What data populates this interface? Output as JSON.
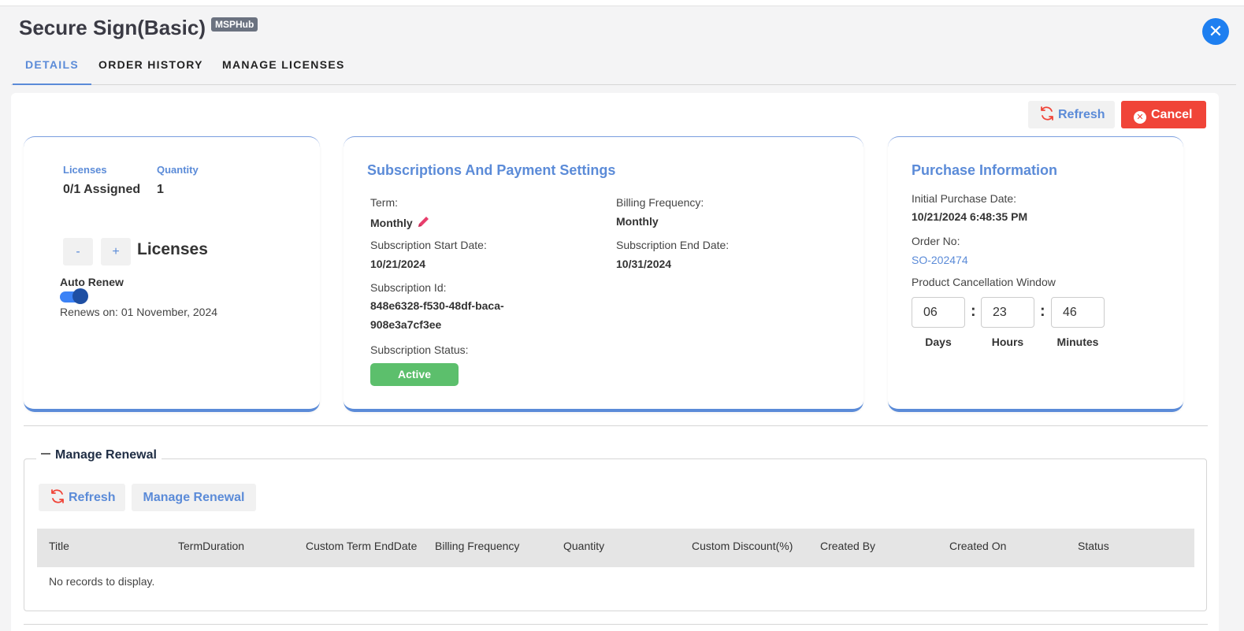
{
  "header": {
    "title": "Secure Sign(Basic)",
    "badge": "MSPHub",
    "close_icon": "close-circle-icon"
  },
  "tabs": [
    {
      "label": "DETAILS",
      "active": true
    },
    {
      "label": "ORDER HISTORY",
      "active": false
    },
    {
      "label": "MANAGE LICENSES",
      "active": false
    }
  ],
  "actions": {
    "refresh_label": "Refresh",
    "cancel_label": "Cancel"
  },
  "licenses_card": {
    "licenses_label": "Licenses",
    "licenses_value": "0/1 Assigned",
    "quantity_label": "Quantity",
    "quantity_value": "1",
    "minus": "-",
    "plus": "+",
    "licenses_word": "Licenses",
    "auto_renew_label": "Auto Renew",
    "auto_renew_on": true,
    "renews_on": "Renews on: 01 November, 2024"
  },
  "subscription_card": {
    "title": "Subscriptions And Payment Settings",
    "term_label": "Term:",
    "term_value": "Monthly",
    "billing_label": "Billing Frequency:",
    "billing_value": "Monthly",
    "start_label": "Subscription Start Date:",
    "start_value": "10/21/2024",
    "end_label": "Subscription End Date:",
    "end_value": "10/31/2024",
    "id_label": "Subscription Id:",
    "id_line1": "848e6328-f530-48df-baca-",
    "id_line2": "908e3a7cf3ee",
    "status_label": "Subscription Status:",
    "status_value": "Active",
    "status_color": "#5cbf6c"
  },
  "purchase_card": {
    "title": "Purchase Information",
    "initial_label": "Initial Purchase Date:",
    "initial_value": "10/21/2024 6:48:35 PM",
    "order_label": "Order No:",
    "order_value": "SO-202474",
    "window_label": "Product Cancellation Window",
    "days": "06",
    "hours": "23",
    "minutes": "46",
    "days_label": "Days",
    "hours_label": "Hours",
    "minutes_label": "Minutes",
    "colon": ":"
  },
  "renewal": {
    "legend": "Manage Renewal",
    "refresh_label": "Refresh",
    "manage_label": "Manage Renewal",
    "columns": [
      "Title",
      "TermDuration",
      "Custom Term EndDate",
      "Billing Frequency",
      "Quantity",
      "Custom Discount(%)",
      "Created By",
      "Created On",
      "Status"
    ],
    "empty_text": "No records to display."
  },
  "colors": {
    "accent": "#5b8bd8",
    "danger": "#f04438",
    "close": "#1e7ff0",
    "success": "#5cbf6c",
    "pencil": "#e83e6c"
  }
}
